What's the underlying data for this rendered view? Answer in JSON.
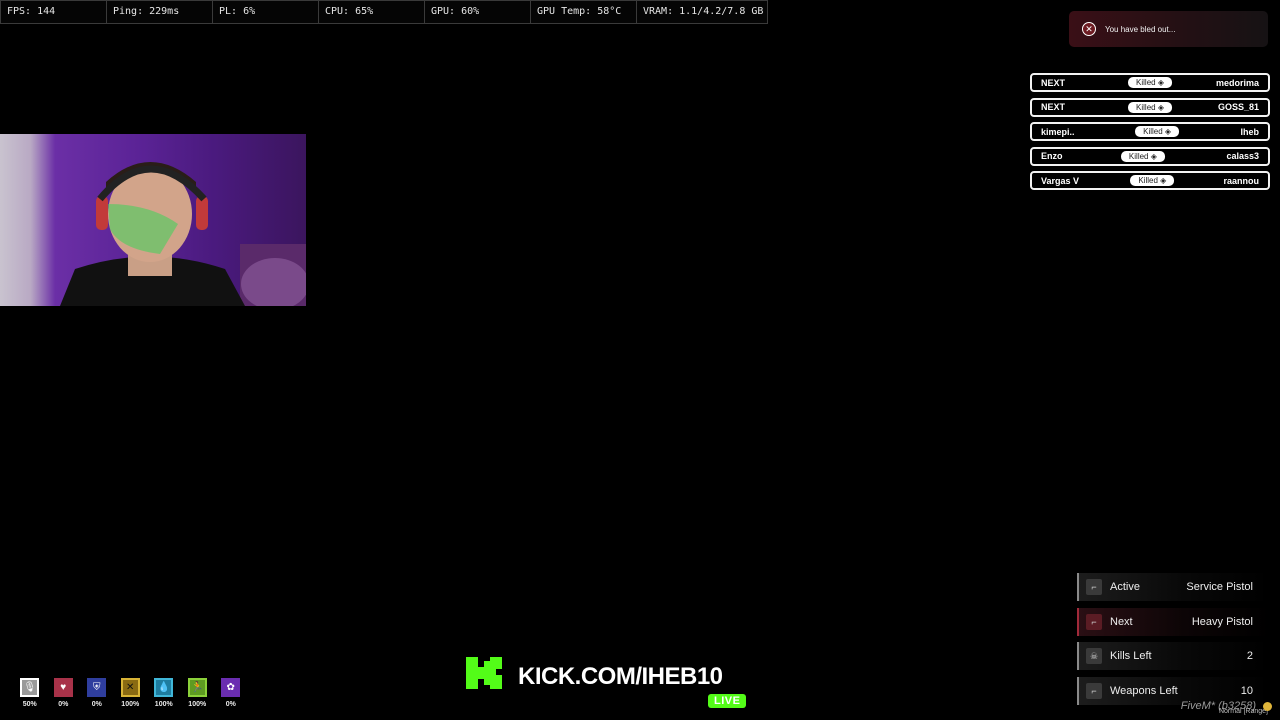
{
  "perf": [
    {
      "label": "FPS: 144"
    },
    {
      "label": "Ping: 229ms"
    },
    {
      "label": "PL: 6%"
    },
    {
      "label": "CPU: 65%"
    },
    {
      "label": "GPU: 60%"
    },
    {
      "label": "GPU Temp: 58°C"
    },
    {
      "label": "VRAM: 1.1/4.2/7.8 GB"
    }
  ],
  "notification": {
    "icon": "close-circle-icon",
    "text": "You have bled out..."
  },
  "killfeed": [
    {
      "killer": "NEXT",
      "action": "Killed ◈",
      "victim": "medorima"
    },
    {
      "killer": "NEXT",
      "action": "Killed ◈",
      "victim": "GOSS_81"
    },
    {
      "killer": "kimepi..",
      "action": "Killed ◈",
      "victim": "Iheb"
    },
    {
      "killer": "Enzo",
      "action": "Killed ◈",
      "victim": "calass3"
    },
    {
      "killer": "Vargas V",
      "action": "Killed ◈",
      "victim": "raannou"
    }
  ],
  "status": [
    {
      "name": "voice",
      "icon": "microphone-icon",
      "value": "50%",
      "color": "#9a9a9a"
    },
    {
      "name": "health",
      "icon": "heart-icon",
      "value": "0%",
      "color": "#a83249"
    },
    {
      "name": "armor",
      "icon": "shield-icon",
      "value": "0%",
      "color": "#2f3e9e"
    },
    {
      "name": "hunger",
      "icon": "fork-knife-icon",
      "value": "100%",
      "color": "#d9b436"
    },
    {
      "name": "thirst",
      "icon": "water-drop-icon",
      "value": "100%",
      "color": "#40b7d9"
    },
    {
      "name": "stamina",
      "icon": "running-icon",
      "value": "100%",
      "color": "#8bd13a"
    },
    {
      "name": "stress",
      "icon": "brain-icon",
      "value": "0%",
      "color": "#6a2db0"
    }
  ],
  "kick": {
    "url": "KICK.COM/IHEB10",
    "live": "LIVE",
    "brand_color": "#53fc18"
  },
  "gungame": [
    {
      "icon": "pistol-icon",
      "label": "Active",
      "value": "Service Pistol"
    },
    {
      "icon": "pistol-icon",
      "label": "Next",
      "value": "Heavy Pistol"
    },
    {
      "icon": "skull-icon",
      "label": "Kills Left",
      "value": "2"
    },
    {
      "icon": "pistol-icon",
      "label": "Weapons Left",
      "value": "10"
    }
  ],
  "footer": {
    "brand": "FiveM* (b3258)",
    "mode": "Normal [Range]"
  }
}
